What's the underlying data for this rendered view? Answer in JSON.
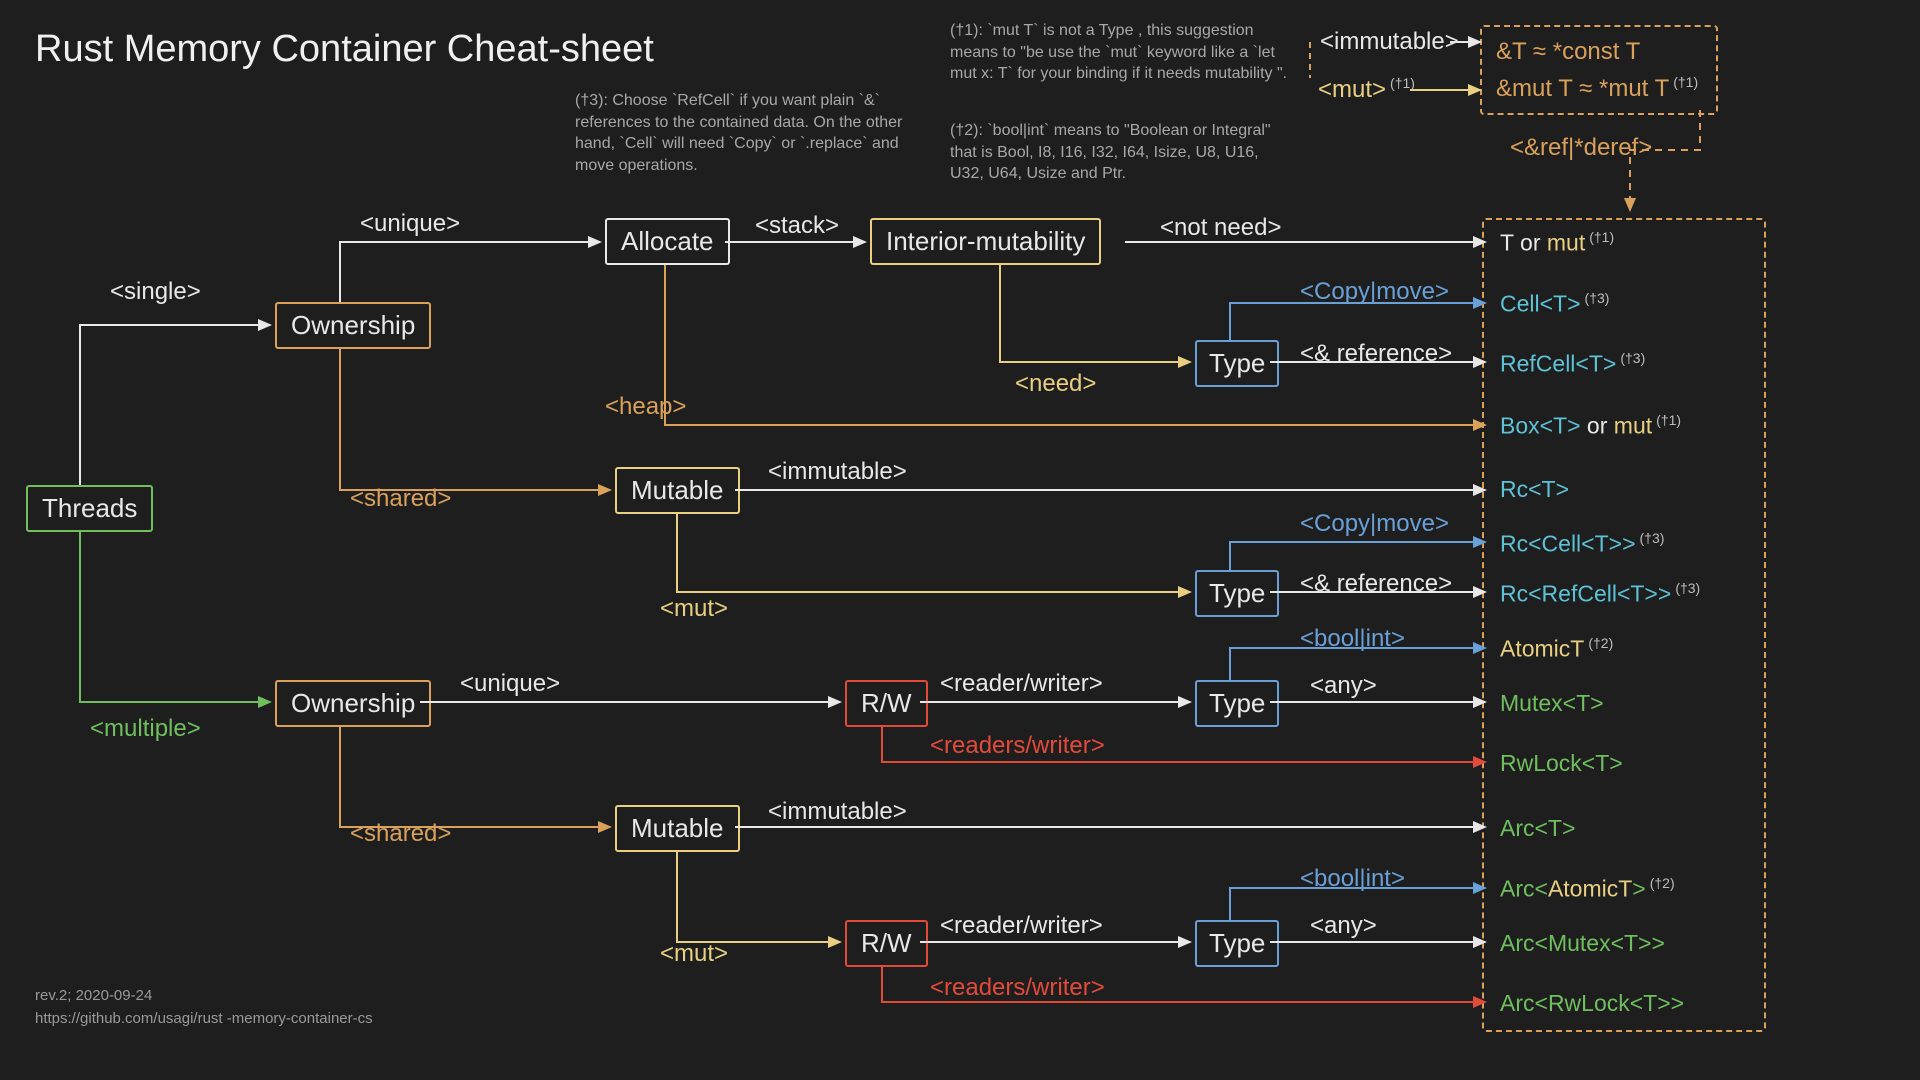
{
  "title": "Rust Memory Container Cheat-sheet",
  "footer_line1": "rev.2; 2020-09-24",
  "footer_line2": "https://github.com/usagi/rust -memory-container-cs",
  "notes": {
    "n3": "(†3): Choose `RefCell` if you want plain `&` references to the contained data. On the other hand, `Cell` will need `Copy` or `.replace` and move operations.",
    "n1": "(†1): `mut T` is not a Type , this suggestion means to \"be use the `mut` keyword like a `let  mut x: T` for your binding if it needs mutability \".",
    "n2": "(†2): `bool|int` means to \"Boolean or Integral\" that is Bool, I8, I16, I32, I64, Isize, U8, U16, U32, U64,  Usize and Ptr."
  },
  "boxes": {
    "threads": "Threads",
    "ownership1": "Ownership",
    "ownership2": "Ownership",
    "allocate": "Allocate",
    "interior": "Interior-mutability",
    "mutable1": "Mutable",
    "mutable2": "Mutable",
    "type1": "Type",
    "type2": "Type",
    "type3": "Type",
    "type4": "Type",
    "rw1": "R/W",
    "rw2": "R/W"
  },
  "labels": {
    "single": "<single>",
    "multiple": "<multiple>",
    "unique": "<unique>",
    "shared": "<shared>",
    "stack": "<stack>",
    "heap": "<heap>",
    "immutable": "<immutable>",
    "mut": "<mut>",
    "need": "<need>",
    "notneed": "<not need>",
    "copymove": "<Copy|move>",
    "ref": "<& reference>",
    "boolint": "<bool|int>",
    "any": "<any>",
    "readerwriter": "<reader/writer>",
    "readerswriter": "<readers/writer>",
    "immut_top": "<immutable>",
    "mut_top": "<mut>",
    "refderef": "<&ref|*deref>"
  },
  "top_equiv": {
    "line1": "&T ≈ *const T",
    "line2": "&mut T ≈ *mut T",
    "line2_sup": "(†1)"
  },
  "leaves": {
    "t_mut": {
      "pre": "T",
      "mid": " or ",
      "suf": "mut",
      "sup": "(†1)"
    },
    "cell": {
      "txt": "Cell<T>",
      "sup": "(†3)"
    },
    "refcell": {
      "txt": "RefCell<T>",
      "sup": "(†3)"
    },
    "box": {
      "pre": "Box<T>",
      "mid": " or ",
      "suf": "mut",
      "sup": "(†1)"
    },
    "rc": "Rc<T>",
    "rccell": {
      "txt": "Rc<Cell<T>>",
      "sup": "(†3)"
    },
    "rcrefcell": {
      "txt": "Rc<RefCell<T>>",
      "sup": "(†3)"
    },
    "atomict": {
      "txt": "AtomicT",
      "sup": "(†2)"
    },
    "mutex": "Mutex<T>",
    "rwlock": "RwLock<T>",
    "arc": "Arc<T>",
    "arcatomic": {
      "pre": "Arc<",
      "mid": "AtomicT",
      "suf": ">",
      "sup": "(†2)"
    },
    "arcmutex": {
      "pre": "Arc<",
      "mid": "Mutex<T>",
      "suf": ">"
    },
    "arcrwlock": {
      "pre": "Arc<",
      "mid": "RwLock<T>",
      "suf": ">"
    }
  },
  "colors": {
    "green": "#6fbf5f",
    "orange": "#d9a15a",
    "yellow": "#e8d080",
    "red": "#e24a3a",
    "blue": "#6aa0d8",
    "cyan": "#5ec2d6",
    "white": "#e8e8e8",
    "grey": "#9a9a9a"
  }
}
